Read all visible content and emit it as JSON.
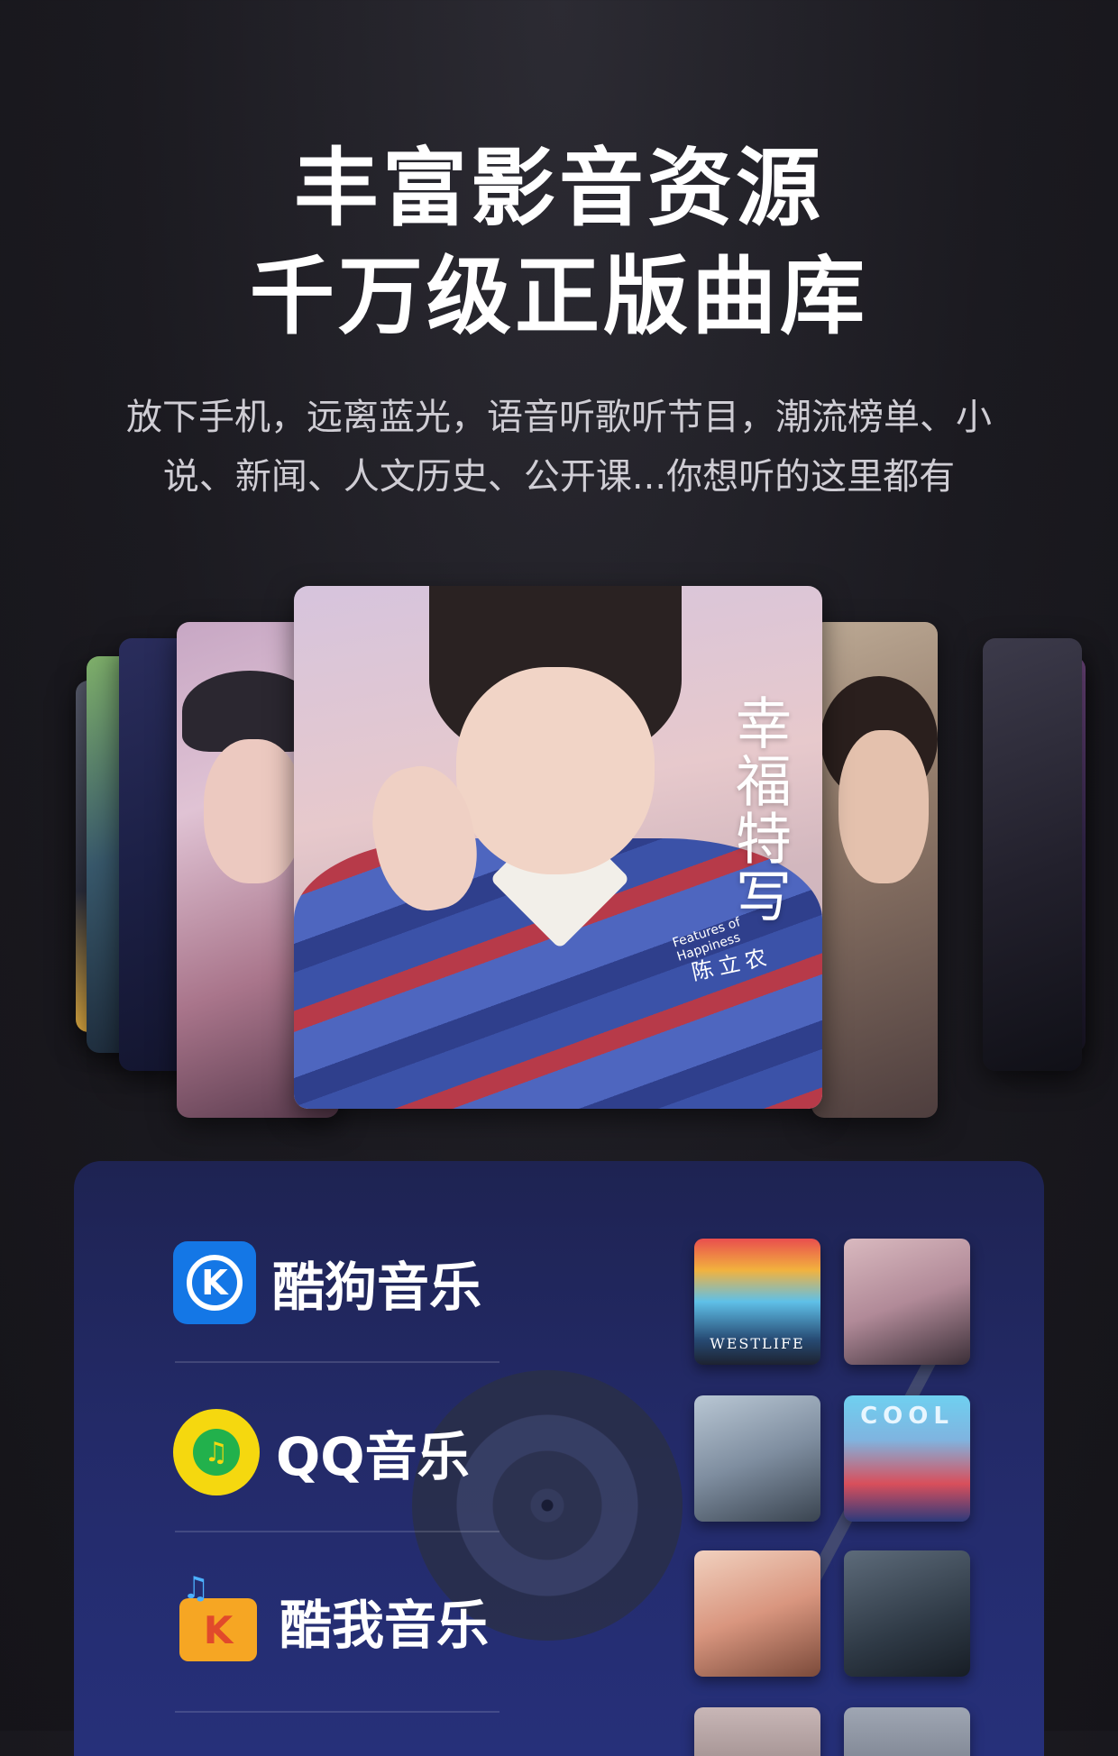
{
  "headline": {
    "line1": "丰富影音资源",
    "line2": "千万级正版曲库"
  },
  "subtitle": {
    "line1": "放下手机，远离蓝光，语音听歌听节目，潮流榜单、小",
    "line2": "说、新闻、人文历史、公开课...你想听的这里都有"
  },
  "featured_album": {
    "title": "幸福特写",
    "subtitle": "Features of Happiness",
    "artist": "陈立农"
  },
  "services": [
    {
      "name": "酷狗音乐",
      "logo_icon": "kugou-logo-icon",
      "logo_glyph": "K",
      "color": "#1477e6"
    },
    {
      "name": "QQ音乐",
      "logo_icon": "qq-music-logo-icon",
      "logo_glyph": "♫",
      "color": "#f5d80f"
    },
    {
      "name": "酷我音乐",
      "logo_icon": "kuwo-logo-icon",
      "logo_glyph": "K",
      "color": "#f6a623"
    }
  ],
  "thumbnails": {
    "t1_label": "WESTLIFE",
    "t4_label": "COOL"
  },
  "colors": {
    "background": "#1b1a20",
    "panel": "#232a68",
    "text": "#ffffff",
    "subtext": "#cfcdd4"
  }
}
